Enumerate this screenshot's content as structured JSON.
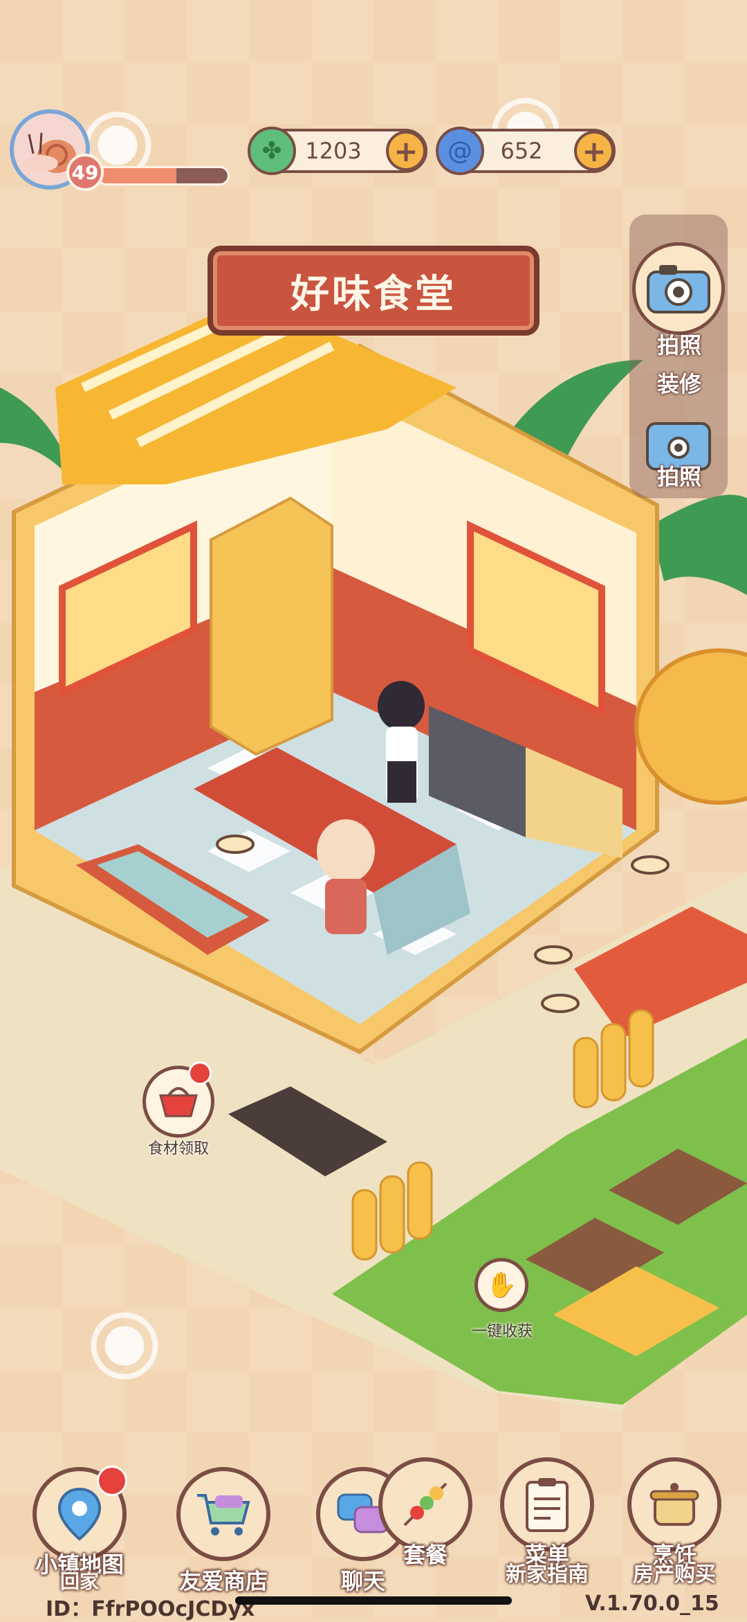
{
  "hud": {
    "level": "49",
    "xp_progress": 0.6,
    "currency": [
      {
        "name": "clover",
        "value": "1203",
        "color": "#5fbf7a"
      },
      {
        "name": "swirl",
        "value": "652",
        "color": "#5b8fe0"
      }
    ]
  },
  "sign_title": "好味食堂",
  "side_menu": {
    "decorate_label_1": "拍照",
    "decorate_label_2": "装修",
    "photo_label": "拍照"
  },
  "scene_buttons": {
    "ingredients": "食材领取",
    "harvest_all": "一键收获"
  },
  "bottom_nav": [
    {
      "label": "小镇地图",
      "sub": "回家",
      "icon": "map-pin-icon"
    },
    {
      "label": "友爱商店",
      "icon": "shopping-cart-icon"
    },
    {
      "label": "聊天",
      "icon": "chat-bubble-icon"
    },
    {
      "label": "套餐",
      "icon": "skewer-icon"
    },
    {
      "label": "菜单",
      "sub": "新家指南",
      "icon": "clipboard-icon"
    },
    {
      "label": "烹饪",
      "sub": "房产购买",
      "icon": "cooking-pot-icon"
    }
  ],
  "footer": {
    "id_text": "ID：FfrPOOcJCDyx",
    "version": "V.1.70.0_15"
  }
}
